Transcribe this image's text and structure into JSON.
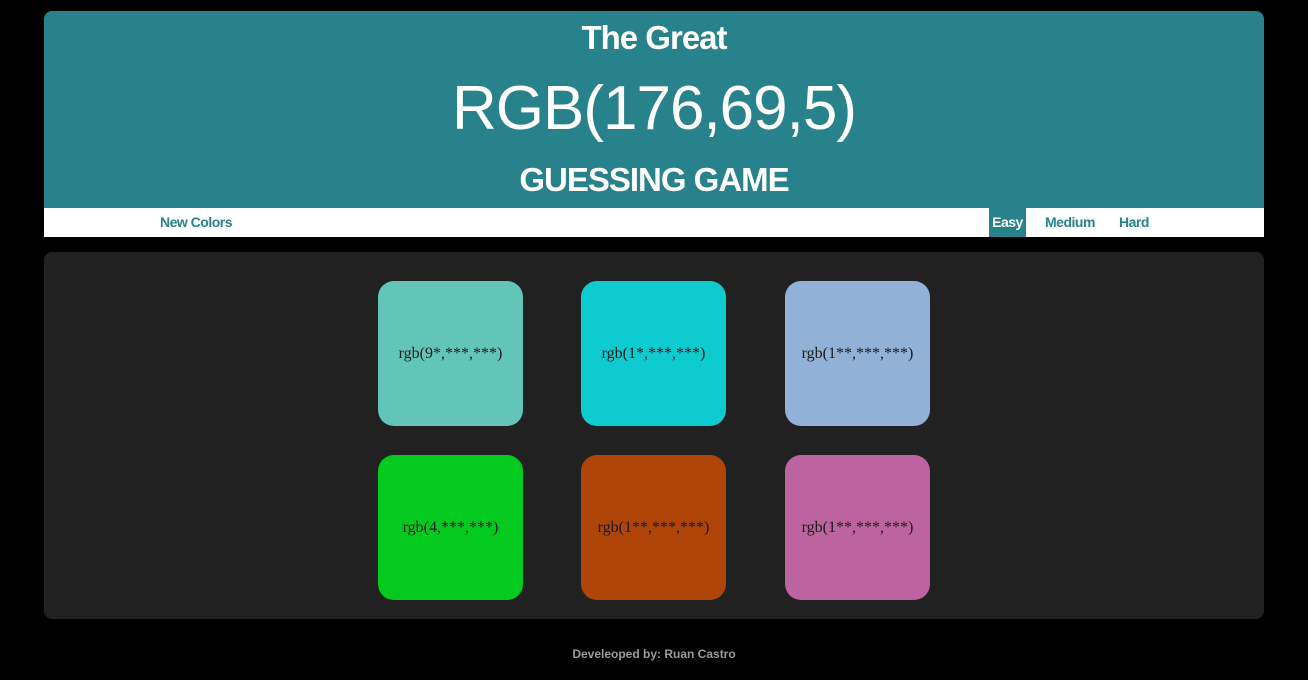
{
  "header": {
    "title_top": "The Great",
    "target_rgb": "RGB(176,69,5)",
    "title_bottom": "GUESSING GAME"
  },
  "menu": {
    "new_colors": "New Colors",
    "modes": [
      "Easy",
      "Medium",
      "Hard"
    ],
    "selected_mode": "Easy"
  },
  "squares": [
    {
      "label": "rgb(9*,***,***)",
      "color": "#62c5b8"
    },
    {
      "label": "rgb(1*,***,***)",
      "color": "#0ecbd0"
    },
    {
      "label": "rgb(1**,***,***)",
      "color": "#91b2d6"
    },
    {
      "label": "rgb(4,***,***)",
      "color": "#04c91f"
    },
    {
      "label": "rgb(1**,***,***)",
      "color": "#b0450a"
    },
    {
      "label": "rgb(1**,***,***)",
      "color": "#bd639f"
    }
  ],
  "footer": {
    "credit": "Develeoped by: Ruan Castro"
  },
  "colors": {
    "accent": "#27828b",
    "board": "#212121",
    "page_background": "#000000"
  }
}
